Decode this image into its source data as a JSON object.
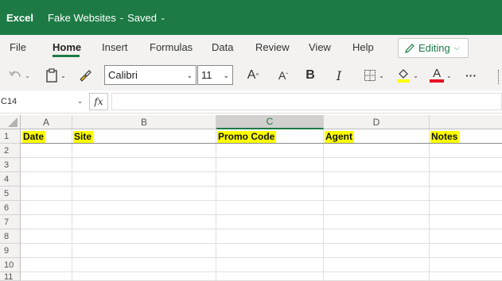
{
  "titlebar": {
    "app": "Excel",
    "document": "Fake Websites",
    "separator": "-",
    "status": "Saved",
    "bg_color": "#1d7a45"
  },
  "menu": {
    "items": [
      "File",
      "Home",
      "Insert",
      "Formulas",
      "Data",
      "Review",
      "View",
      "Help"
    ],
    "active": "Home",
    "editing_label": "Editing"
  },
  "toolbar": {
    "font_name": "Calibri",
    "font_size": "11",
    "increase_font": "A",
    "decrease_font": "A",
    "bold": "B",
    "italic": "I",
    "font_color_letter": "A",
    "more": "···",
    "highlight_color": "#ffff00",
    "font_color": "#e81123"
  },
  "formula": {
    "name_box": "C14",
    "fx": "fx",
    "value": ""
  },
  "grid": {
    "columns": [
      "A",
      "B",
      "C",
      "D",
      ""
    ],
    "selected_column": "C",
    "rows": [
      "1",
      "2",
      "3",
      "4",
      "5",
      "6",
      "7",
      "8",
      "9",
      "10",
      "11"
    ],
    "headers": {
      "A": "Date",
      "B": "Site",
      "C": "Promo Code",
      "D": "Agent",
      "E": "Notes"
    },
    "highlight": "#ffff00"
  }
}
